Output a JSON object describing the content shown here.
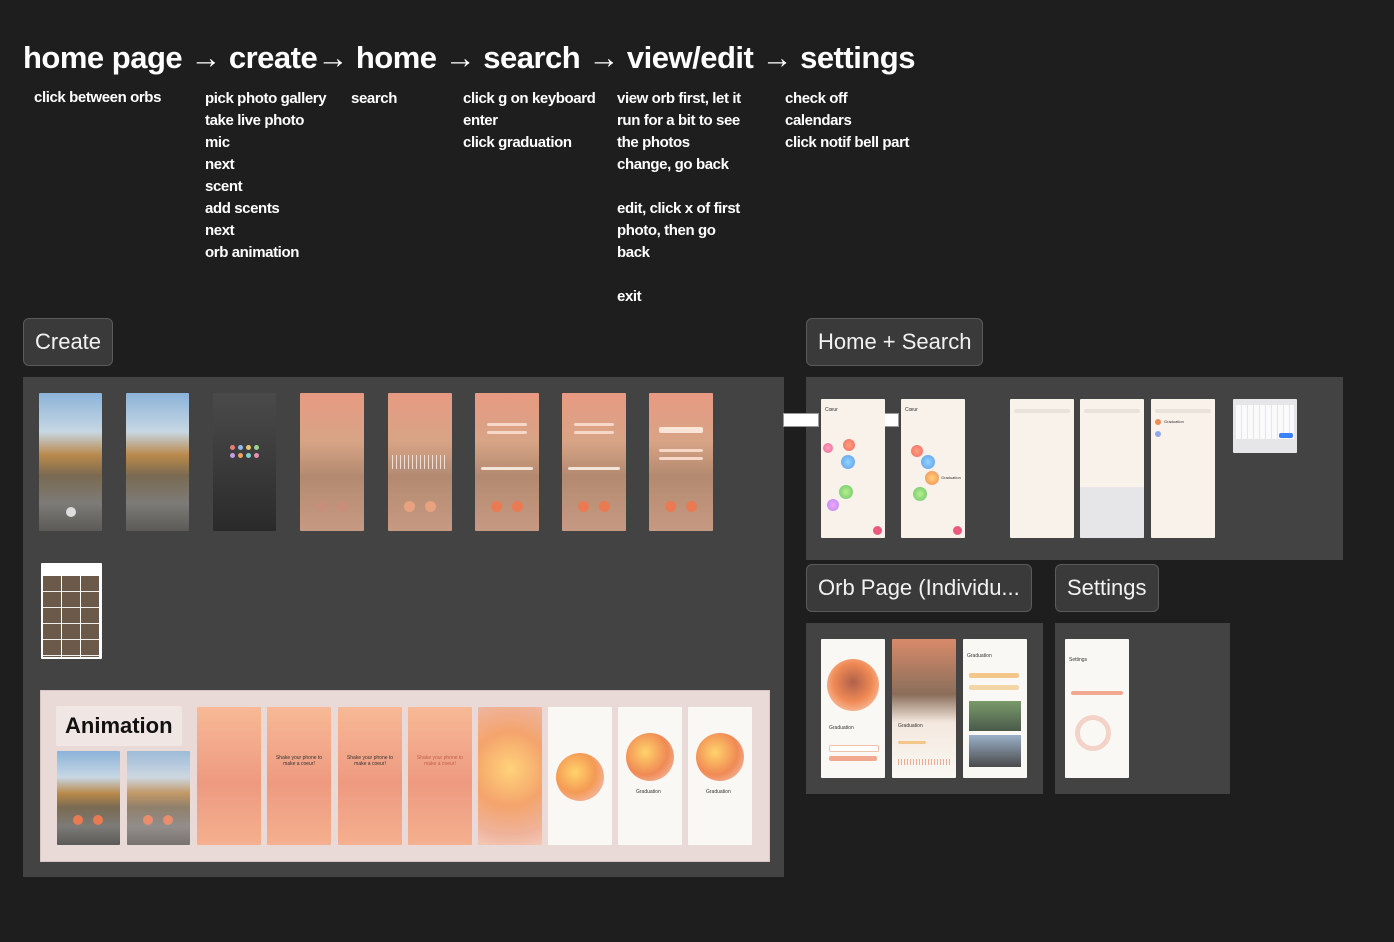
{
  "flow_title": "home page → create→ home → search → view/edit → settings",
  "steps": [
    {
      "id": "home",
      "lines": [
        "click between orbs"
      ]
    },
    {
      "id": "create",
      "lines": [
        "pick photo gallery",
        "take live photo",
        "mic",
        "next",
        "scent",
        "add scents",
        "next",
        "orb animation"
      ]
    },
    {
      "id": "home2",
      "lines": [
        "search"
      ]
    },
    {
      "id": "search",
      "lines": [
        "click g on keyboard",
        "enter",
        "click graduation"
      ]
    },
    {
      "id": "viewedit",
      "lines": [
        "view orb first, let it",
        "run for a bit to see",
        "the photos",
        "change, go back",
        "",
        "edit, click x of first",
        "photo, then go",
        "back",
        "",
        "exit"
      ]
    },
    {
      "id": "settings",
      "lines": [
        "check off",
        "calendars",
        "click notif bell part"
      ]
    }
  ],
  "sections": {
    "create": "Create",
    "home_search": "Home + Search",
    "orb_page": "Orb Page (Individu...",
    "settings": "Settings",
    "animation": "Animation"
  },
  "screen_text": {
    "shake": "Shake your phone to make a coeur!",
    "graduation": "Graduation",
    "coeur": "Cœur",
    "settings_title": "Settings"
  },
  "colors": {
    "background": "#1e1e1e",
    "panel": "#434343",
    "accent_peach": "#ee9a80",
    "animation_bg": "#eadad7"
  }
}
